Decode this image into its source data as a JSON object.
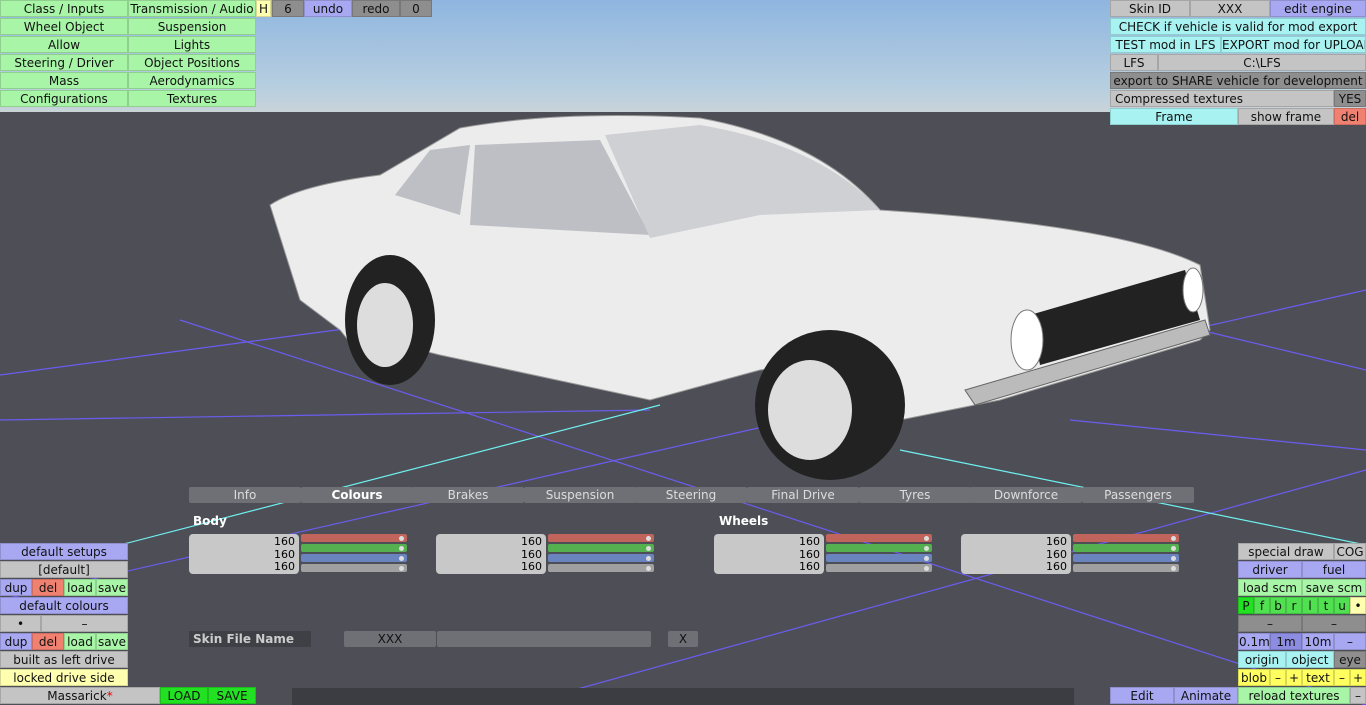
{
  "menu": {
    "left": [
      "Class / Inputs",
      "Wheel Object",
      "Allow",
      "Steering / Driver",
      "Mass",
      "Configurations"
    ],
    "right": [
      "Transmission / Audio",
      "Suspension",
      "Lights",
      "Object Positions",
      "Aerodynamics",
      "Textures"
    ]
  },
  "toolbar": {
    "h": "H",
    "count": "6",
    "undo": "undo",
    "redo": "redo",
    "zero": "0"
  },
  "topright": {
    "skin_id": "Skin ID",
    "skin_value": "XXX",
    "edit_engine": "edit engine",
    "check": "CHECK if vehicle is valid for mod export",
    "test": "TEST mod in LFS",
    "export": "EXPORT mod for UPLOAD",
    "lfs": "LFS",
    "path": "C:\\LFS",
    "share": "export to SHARE vehicle for development",
    "compressed": "Compressed textures",
    "compressed_value": "YES",
    "frame": "Frame",
    "show_frame": "show frame",
    "del": "del"
  },
  "tabs": [
    "Info",
    "Colours",
    "Brakes",
    "Suspension",
    "Steering",
    "Final Drive",
    "Tyres",
    "Downforce",
    "Passengers"
  ],
  "active_tab": "Colours",
  "colours": {
    "body_label": "Body",
    "wheels_label": "Wheels",
    "groups": [
      [
        "160",
        "160",
        "160"
      ],
      [
        "160",
        "160",
        "160"
      ],
      [
        "160",
        "160",
        "160"
      ],
      [
        "160",
        "160",
        "160"
      ]
    ]
  },
  "skin": {
    "label": "Skin File Name",
    "value": "XXX",
    "clear": "X"
  },
  "leftpanel": {
    "default_setups": "default setups",
    "setup_value": "[default]",
    "dup": "dup",
    "del": "del",
    "load": "load",
    "save": "save",
    "default_colours": "default colours",
    "dot": "•",
    "dash": "–",
    "left_drive": "built as left drive",
    "locked": "locked drive side",
    "name": "Massarick",
    "modified": "*",
    "LOAD": "LOAD",
    "SAVE": "SAVE"
  },
  "rightpanel": {
    "special_draw": "special draw",
    "cog": "COG",
    "driver": "driver",
    "fuel": "fuel",
    "load_scm": "load scm",
    "save_scm": "save scm",
    "toggles": [
      "P",
      "f",
      "b",
      "r",
      "l",
      "t",
      "u"
    ],
    "dot": "•",
    "dash": "–",
    "scales": [
      "0.1m",
      "1m",
      "10m"
    ],
    "origin": "origin",
    "object": "object",
    "eye": "eye",
    "blob": "blob",
    "minus": "–",
    "plus": "+",
    "text": "text",
    "reload": "reload textures",
    "edit": "Edit",
    "animate": "Animate"
  }
}
